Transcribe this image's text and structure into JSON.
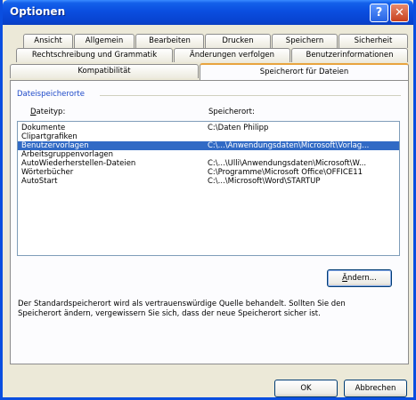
{
  "window": {
    "title": "Optionen",
    "help_label": "?",
    "close_label": "✕"
  },
  "tabs": {
    "row1": [
      "Ansicht",
      "Allgemein",
      "Bearbeiten",
      "Drucken",
      "Speichern",
      "Sicherheit"
    ],
    "row2": [
      "Rechtschreibung und Grammatik",
      "Änderungen verfolgen",
      "Benutzerinformationen"
    ],
    "row3": [
      "Kompatibilität",
      "Speicherort für Dateien"
    ],
    "active": "Speicherort für Dateien"
  },
  "panel": {
    "group_label": "Dateispeicherorte",
    "col_type": "Dateityp:",
    "col_location": "Speicherort:",
    "rows": [
      {
        "type": "Dokumente",
        "location": "C:\\Daten Philipp"
      },
      {
        "type": "Clipartgrafiken",
        "location": ""
      },
      {
        "type": "Benutzervorlagen",
        "location": "C:\\...\\Anwendungsdaten\\Microsoft\\Vorlag..."
      },
      {
        "type": "Arbeitsgruppenvorlagen",
        "location": ""
      },
      {
        "type": "AutoWiederherstellen-Dateien",
        "location": "C:\\...\\Ulli\\Anwendungsdaten\\Microsoft\\W..."
      },
      {
        "type": "Wörterbücher",
        "location": "C:\\Programme\\Microsoft Office\\OFFICE11"
      },
      {
        "type": "AutoStart",
        "location": "C:\\...\\Microsoft\\Word\\STARTUP"
      }
    ],
    "selected_index": 2,
    "change_button": "Ändern...",
    "change_button_accel": "Ä",
    "change_button_rest": "ndern...",
    "hint": "Der Standardspeicherort wird als vertrauenswürdige Quelle behandelt. Sollten Sie den Speicherort ändern, vergewissern Sie sich, dass der neue Speicherort sicher ist."
  },
  "footer": {
    "ok": "OK",
    "cancel": "Abbrechen"
  }
}
